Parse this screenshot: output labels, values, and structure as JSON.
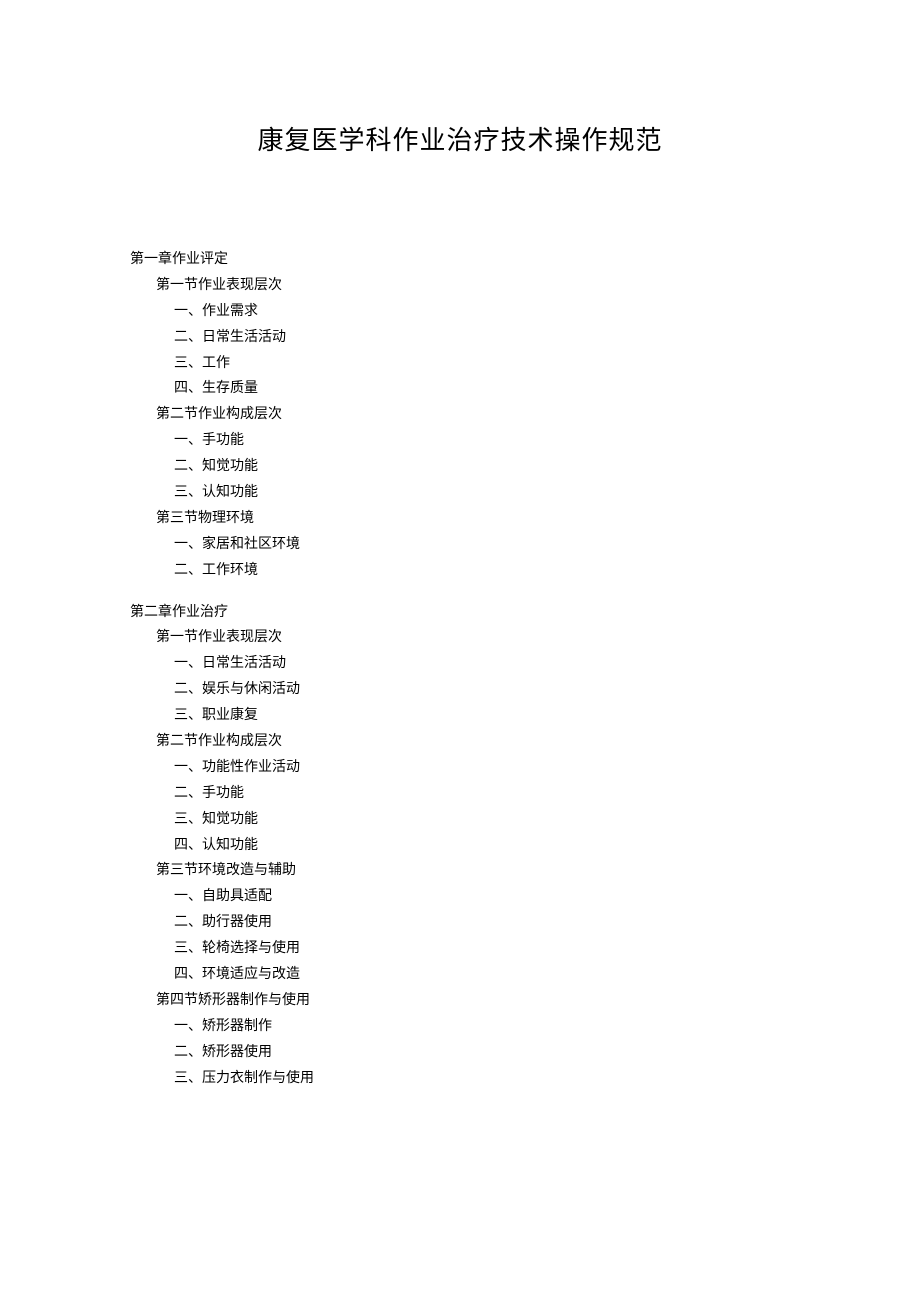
{
  "title": "康复医学科作业治疗技术操作规范",
  "toc": [
    {
      "level": 1,
      "label": "第一章作业评定"
    },
    {
      "level": 2,
      "label": "第一节作业表现层次"
    },
    {
      "level": 3,
      "label": "一、作业需求"
    },
    {
      "level": 3,
      "label": "二、日常生活活动"
    },
    {
      "level": 3,
      "label": "三、工作"
    },
    {
      "level": 3,
      "label": "四、生存质量"
    },
    {
      "level": 2,
      "label": "第二节作业构成层次"
    },
    {
      "level": 3,
      "label": "一、手功能"
    },
    {
      "level": 3,
      "label": "二、知觉功能"
    },
    {
      "level": 3,
      "label": "三、认知功能"
    },
    {
      "level": 2,
      "label": "第三节物理环境"
    },
    {
      "level": 3,
      "label": "一、家居和社区环境"
    },
    {
      "level": 3,
      "label": "二、工作环境"
    },
    {
      "gap": true
    },
    {
      "level": 1,
      "label": "第二章作业治疗"
    },
    {
      "level": 2,
      "label": "第一节作业表现层次"
    },
    {
      "level": 3,
      "label": "一、日常生活活动"
    },
    {
      "level": 3,
      "label": "二、娱乐与休闲活动"
    },
    {
      "level": 3,
      "label": "三、职业康复"
    },
    {
      "level": 2,
      "label": "第二节作业构成层次"
    },
    {
      "level": 3,
      "label": "一、功能性作业活动"
    },
    {
      "level": 3,
      "label": "二、手功能"
    },
    {
      "level": 3,
      "label": "三、知觉功能"
    },
    {
      "level": 3,
      "label": "四、认知功能"
    },
    {
      "level": 2,
      "label": "第三节环境改造与辅助"
    },
    {
      "level": 3,
      "label": "一、自助具适配"
    },
    {
      "level": 3,
      "label": "二、助行器使用"
    },
    {
      "level": 3,
      "label": "三、轮椅选择与使用"
    },
    {
      "level": 3,
      "label": "四、环境适应与改造"
    },
    {
      "level": 2,
      "label": "第四节矫形器制作与使用"
    },
    {
      "level": 3,
      "label": "一、矫形器制作"
    },
    {
      "level": 3,
      "label": "二、矫形器使用"
    },
    {
      "level": 3,
      "label": "三、压力衣制作与使用"
    }
  ]
}
